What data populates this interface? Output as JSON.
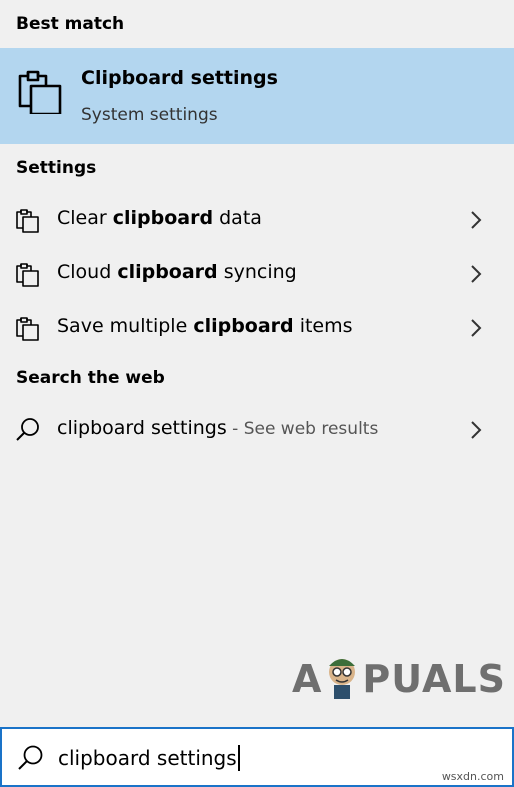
{
  "sections": {
    "best_match": "Best match",
    "settings": "Settings",
    "search_web": "Search the web"
  },
  "best_match": {
    "title": "Clipboard settings",
    "subtitle": "System settings",
    "icon": "clipboard-icon"
  },
  "settings_items": [
    {
      "pre": "Clear ",
      "bold": "clipboard",
      "post": " data",
      "icon": "clipboard-icon"
    },
    {
      "pre": "Cloud ",
      "bold": "clipboard",
      "post": " syncing",
      "icon": "clipboard-icon"
    },
    {
      "pre": "Save multiple ",
      "bold": "clipboard",
      "post": " items",
      "icon": "clipboard-icon"
    }
  ],
  "web_result": {
    "query": "clipboard settings",
    "suffix": " - See web results",
    "icon": "search-icon"
  },
  "search_box": {
    "value": "clipboard settings",
    "icon": "search-icon"
  },
  "watermark": {
    "pre": "A",
    "post": "PUALS"
  },
  "credit": "wsxdn.com",
  "colors": {
    "background": "#f0f0f0",
    "highlight": "#b3d6ef",
    "search_border": "#1a73c8"
  }
}
